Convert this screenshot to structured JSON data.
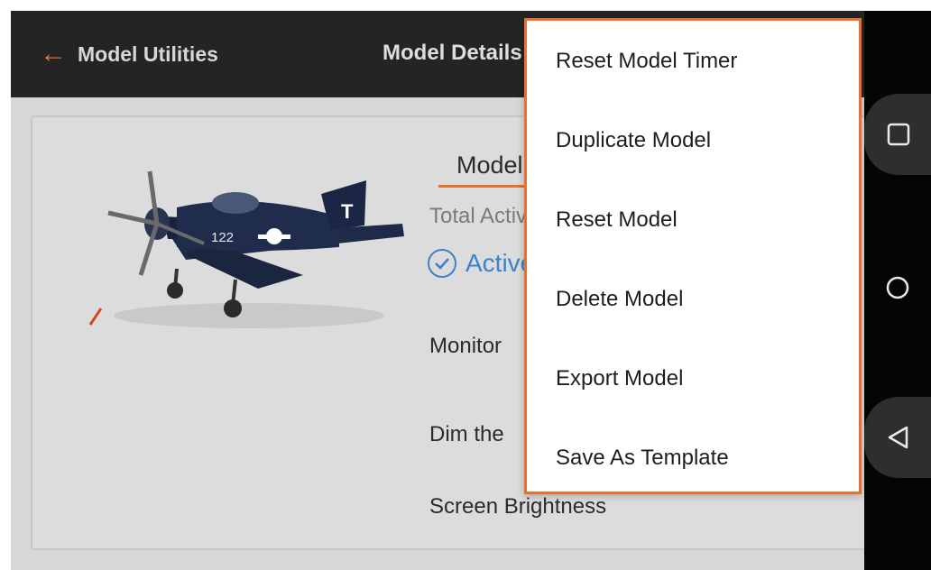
{
  "header": {
    "back_label": "Model Utilities",
    "title": "Model Details"
  },
  "card": {
    "tab_label": "Model",
    "total_label": "Total Active Time",
    "active_label": "Active",
    "rows": [
      "Monitor",
      "Dim the",
      "Screen Brightness"
    ]
  },
  "plane": {
    "tail_letter": "T",
    "fuselage_number": "122"
  },
  "menu": {
    "items": [
      "Reset Model Timer",
      "Duplicate Model",
      "Reset Model",
      "Delete Model",
      "Export Model",
      "Save As Template"
    ]
  },
  "nav": {
    "recents_icon": "square-icon",
    "home_icon": "circle-icon",
    "back_icon": "triangle-back-icon"
  },
  "colors": {
    "accent": "#e8702a",
    "active": "#3c82c8",
    "header_bg": "#242424",
    "nav_bg": "#050505"
  }
}
